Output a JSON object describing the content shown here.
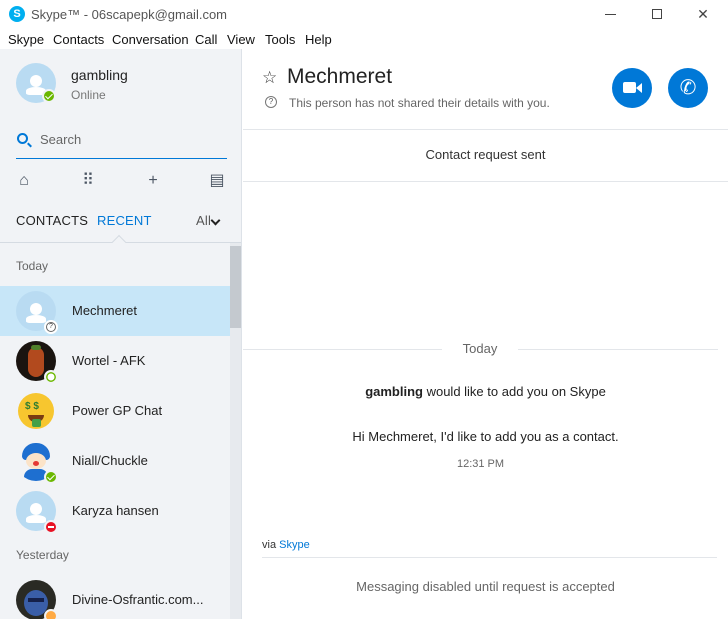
{
  "window": {
    "title": "Skype™ - 06scapepk@gmail.com",
    "minimize_glyph": "—",
    "maximize_glyph": "□",
    "close_glyph": "✕"
  },
  "menu": [
    "Skype",
    "Contacts",
    "Conversation",
    "Call",
    "View",
    "Tools",
    "Help"
  ],
  "profile": {
    "name": "gambling",
    "status": "Online"
  },
  "search": {
    "placeholder": "Search"
  },
  "toolbar": {
    "icons": [
      "home-icon",
      "dialpad-icon",
      "add-icon",
      "directory-icon"
    ],
    "home_glyph": "⌂",
    "dialpad_glyph": "⠿",
    "add_glyph": "+",
    "directory_glyph": "▤"
  },
  "tabs": {
    "contacts": "CONTACTS",
    "recent": "RECENT",
    "filter": "All"
  },
  "sections": {
    "today": "Today",
    "yesterday": "Yesterday"
  },
  "contacts": [
    {
      "name": "Mechmeret",
      "status": "unknown",
      "selected": true
    },
    {
      "name": "Wortel - AFK",
      "status": "offline",
      "selected": false
    },
    {
      "name": "Power GP Chat",
      "status": "none",
      "selected": false
    },
    {
      "name": "Niall/Chuckle",
      "status": "online",
      "selected": false
    },
    {
      "name": "Karyza hansen",
      "status": "busy",
      "selected": false
    },
    {
      "name": "Divine-Osfrantic.com...",
      "status": "away",
      "selected": false
    }
  ],
  "chat": {
    "title": "Mechmeret",
    "info": "This person has not shared their details with you.",
    "request_banner": "Contact request sent",
    "day_label": "Today",
    "request_sender": "gambling",
    "request_text": " would like to add you on Skype",
    "request_message": "Hi Mechmeret, I'd like to add you as a contact.",
    "request_time": "12:31 PM",
    "via_prefix": "via ",
    "via_link": "Skype",
    "composer_status": "Messaging disabled until request is accepted"
  },
  "colors": {
    "accent": "#0078d7",
    "selected_row": "#c7e6f8",
    "sidebar_bg": "#f1f3f6",
    "online": "#6bb700",
    "busy": "#e81123"
  }
}
